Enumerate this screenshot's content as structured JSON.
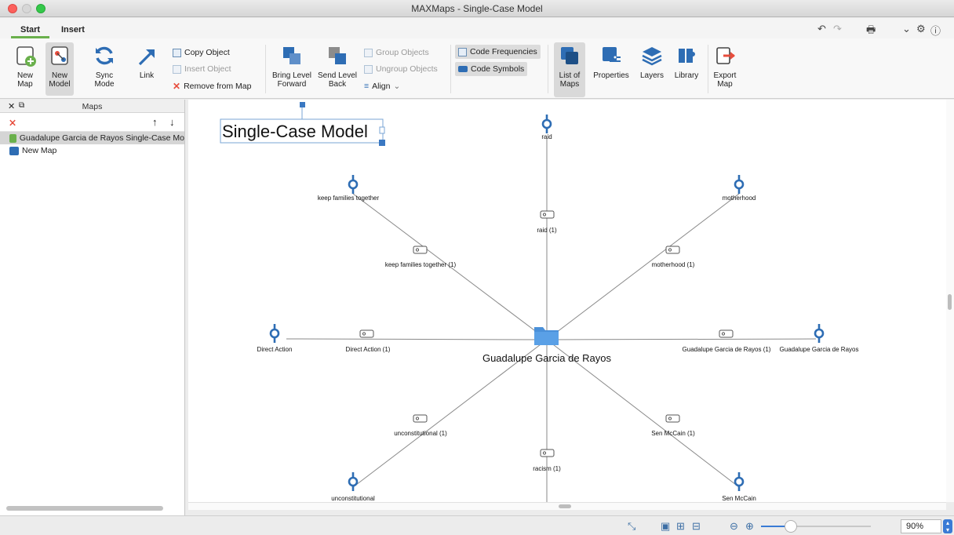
{
  "window": {
    "title": "MAXMaps - Single-Case Model"
  },
  "tabs": [
    {
      "label": "Start",
      "active": true
    },
    {
      "label": "Insert",
      "active": false
    }
  ],
  "ribbon": {
    "new_map": {
      "line1": "New",
      "line2": "Map"
    },
    "new_model": {
      "line1": "New",
      "line2": "Model"
    },
    "sync_mode": {
      "line1": "Sync",
      "line2": "Mode"
    },
    "link": {
      "line1": "Link"
    },
    "copy_object": "Copy Object",
    "insert_object": "Insert Object",
    "remove_from_map": "Remove from Map",
    "bring_level_forward": {
      "line1": "Bring Level",
      "line2": "Forward"
    },
    "send_level_back": {
      "line1": "Send Level",
      "line2": "Back"
    },
    "group_objects": "Group Objects",
    "ungroup_objects": "Ungroup Objects",
    "align": "Align",
    "code_frequencies": "Code Frequencies",
    "code_symbols": "Code Symbols",
    "list_of_maps": {
      "line1": "List of",
      "line2": "Maps"
    },
    "properties": {
      "line1": "Properties"
    },
    "layers": {
      "line1": "Layers"
    },
    "library": {
      "line1": "Library"
    },
    "export_map": {
      "line1": "Export",
      "line2": "Map"
    }
  },
  "panel": {
    "title": "Maps",
    "items": [
      {
        "label": "Guadalupe Garcia de Rayos Single-Case Mo",
        "selected": true
      },
      {
        "label": "New Map",
        "selected": false
      }
    ]
  },
  "map": {
    "title": "Single-Case Model",
    "center": "Guadalupe Garcia de Rayos",
    "codes": {
      "raid": "raid",
      "keep": "keep families together",
      "motherhood": "motherhood",
      "direct": "Direct Action",
      "guadalupe": "Guadalupe Garcia de Rayos",
      "unconstitutional": "unconstitutional",
      "mccain": "Sen McCain"
    },
    "segments": {
      "raid": "raid (1)",
      "keep": "keep families together (1)",
      "motherhood": "motherhood (1)",
      "direct": "Direct Action (1)",
      "guadalupe": "Guadalupe Garcia de Rayos (1)",
      "unconstitutional": "unconstitutional (1)",
      "mccain": "Sen McCain (1)",
      "racism": "racism (1)"
    }
  },
  "status": {
    "zoom": "90%",
    "zoom_fraction": 0.24
  },
  "colors": {
    "accent": "#3a7bd5",
    "code_blue": "#2e6db4",
    "folder_blue": "#4a90d9",
    "tab_green": "#6ab04c"
  }
}
